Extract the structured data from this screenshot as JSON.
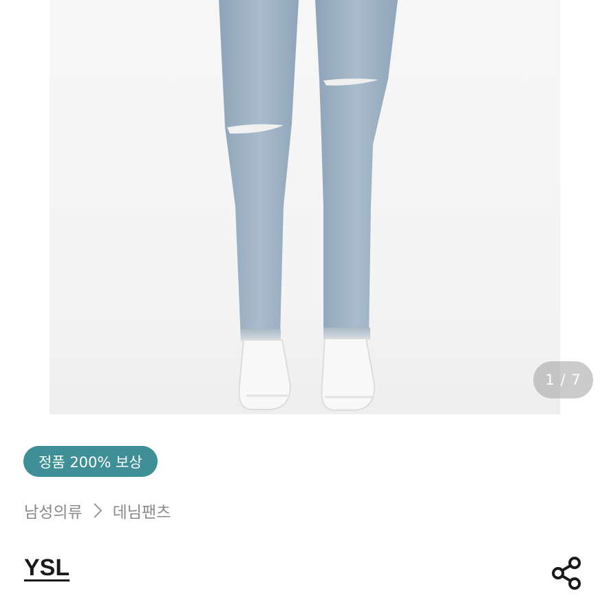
{
  "gallery": {
    "image_alt": "product photo - light blue ripped jeans with white sneakers",
    "counter_text": "1 / 7",
    "current_index": 1,
    "total_images": 7
  },
  "badge": {
    "label": "정품 200% 보상",
    "color": "#3f8f97"
  },
  "breadcrumb": {
    "items": [
      {
        "label": "남성의류"
      },
      {
        "label": "데님팬츠"
      }
    ],
    "separator_icon": "chevron-right-icon"
  },
  "product": {
    "brand": "YSL"
  },
  "actions": {
    "share_icon": "share-icon"
  }
}
